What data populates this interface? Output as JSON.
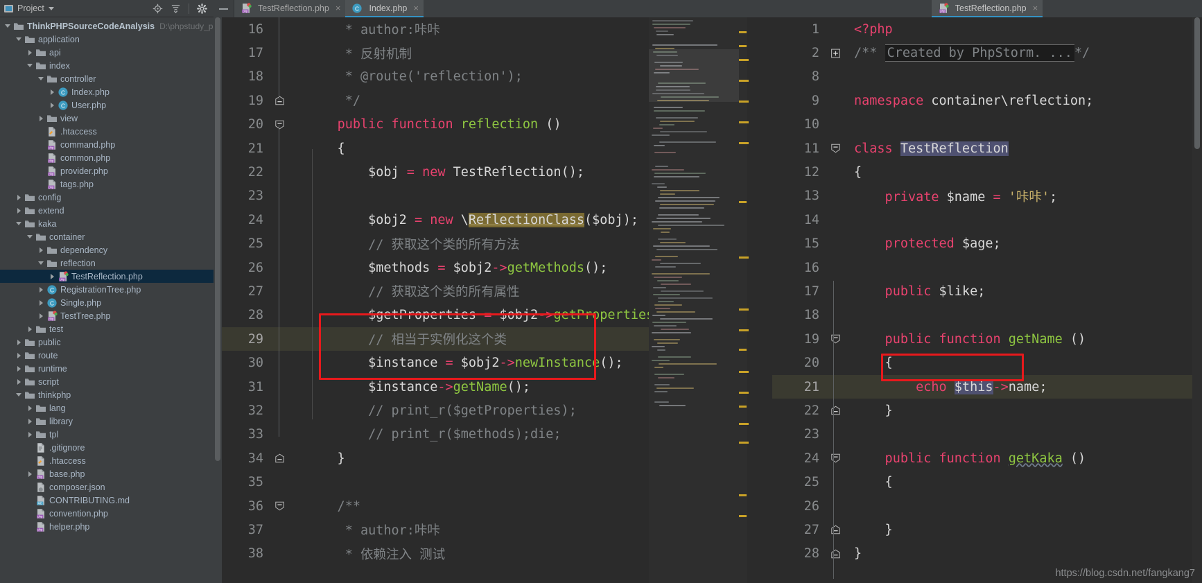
{
  "project_panel": {
    "header": {
      "title": "Project",
      "caret_icon": "chevron-down-icon",
      "icons": [
        "locate-icon",
        "collapse-all-icon",
        "settings-gear-icon"
      ]
    },
    "tree": [
      {
        "depth": 0,
        "arrow": "open",
        "icon": "folder-module",
        "label": "ThinkPHPSourceCodeAnalysis",
        "bold": true,
        "sub": "D:\\phpstudy_pro\\W"
      },
      {
        "depth": 1,
        "arrow": "open",
        "icon": "folder",
        "label": "application"
      },
      {
        "depth": 2,
        "arrow": "closed",
        "icon": "folder",
        "label": "api"
      },
      {
        "depth": 2,
        "arrow": "open",
        "icon": "folder",
        "label": "index"
      },
      {
        "depth": 3,
        "arrow": "open",
        "icon": "folder",
        "label": "controller"
      },
      {
        "depth": 4,
        "arrow": "closed",
        "icon": "php-class",
        "label": "Index.php"
      },
      {
        "depth": 4,
        "arrow": "closed",
        "icon": "php-class",
        "label": "User.php"
      },
      {
        "depth": 3,
        "arrow": "closed",
        "icon": "folder",
        "label": "view"
      },
      {
        "depth": 3,
        "arrow": "none",
        "icon": "htaccess",
        "label": ".htaccess"
      },
      {
        "depth": 3,
        "arrow": "none",
        "icon": "php-file",
        "label": "command.php"
      },
      {
        "depth": 3,
        "arrow": "none",
        "icon": "php-file",
        "label": "common.php"
      },
      {
        "depth": 3,
        "arrow": "none",
        "icon": "php-file",
        "label": "provider.php"
      },
      {
        "depth": 3,
        "arrow": "none",
        "icon": "php-file",
        "label": "tags.php"
      },
      {
        "depth": 1,
        "arrow": "closed",
        "icon": "folder",
        "label": "config"
      },
      {
        "depth": 1,
        "arrow": "closed",
        "icon": "folder",
        "label": "extend"
      },
      {
        "depth": 1,
        "arrow": "open",
        "icon": "folder",
        "label": "kaka"
      },
      {
        "depth": 2,
        "arrow": "open",
        "icon": "folder",
        "label": "container"
      },
      {
        "depth": 3,
        "arrow": "closed",
        "icon": "folder",
        "label": "dependency"
      },
      {
        "depth": 3,
        "arrow": "open",
        "icon": "folder",
        "label": "reflection"
      },
      {
        "depth": 4,
        "arrow": "closed",
        "icon": "php-test",
        "label": "TestReflection.php",
        "selected": true
      },
      {
        "depth": 3,
        "arrow": "closed",
        "icon": "php-class",
        "label": "RegistrationTree.php"
      },
      {
        "depth": 3,
        "arrow": "closed",
        "icon": "php-class",
        "label": "Single.php"
      },
      {
        "depth": 3,
        "arrow": "closed",
        "icon": "php-test",
        "label": "TestTree.php"
      },
      {
        "depth": 2,
        "arrow": "closed",
        "icon": "folder",
        "label": "test"
      },
      {
        "depth": 1,
        "arrow": "closed",
        "icon": "folder",
        "label": "public"
      },
      {
        "depth": 1,
        "arrow": "closed",
        "icon": "folder",
        "label": "route"
      },
      {
        "depth": 1,
        "arrow": "closed",
        "icon": "folder",
        "label": "runtime"
      },
      {
        "depth": 1,
        "arrow": "closed",
        "icon": "folder",
        "label": "script"
      },
      {
        "depth": 1,
        "arrow": "open",
        "icon": "folder",
        "label": "thinkphp"
      },
      {
        "depth": 2,
        "arrow": "closed",
        "icon": "folder",
        "label": "lang"
      },
      {
        "depth": 2,
        "arrow": "closed",
        "icon": "folder",
        "label": "library"
      },
      {
        "depth": 2,
        "arrow": "closed",
        "icon": "folder",
        "label": "tpl"
      },
      {
        "depth": 2,
        "arrow": "none",
        "icon": "text-file",
        "label": ".gitignore"
      },
      {
        "depth": 2,
        "arrow": "none",
        "icon": "htaccess",
        "label": ".htaccess"
      },
      {
        "depth": 2,
        "arrow": "closed",
        "icon": "php-file",
        "label": "base.php"
      },
      {
        "depth": 2,
        "arrow": "none",
        "icon": "json-file",
        "label": "composer.json"
      },
      {
        "depth": 2,
        "arrow": "none",
        "icon": "md-file",
        "label": "CONTRIBUTING.md"
      },
      {
        "depth": 2,
        "arrow": "none",
        "icon": "php-file",
        "label": "convention.php"
      },
      {
        "depth": 2,
        "arrow": "none",
        "icon": "php-file",
        "label": "helper.php"
      }
    ]
  },
  "left_tabs": {
    "collapse_icon": "minimize-icon",
    "tabs": [
      {
        "label": "TestReflection.php",
        "icon": "php-test-icon",
        "active": false,
        "close": "×"
      },
      {
        "label": "Index.php",
        "icon": "php-class-icon",
        "active": true,
        "close": "×"
      }
    ]
  },
  "right_tabs": {
    "tabs": [
      {
        "label": "TestReflection.php",
        "icon": "php-test-icon",
        "active": true,
        "close": "×"
      }
    ]
  },
  "browser_popup": {
    "name": "browser-launcher-popup",
    "browsers": [
      "chrome-icon",
      "edge-icon",
      "opera-icon",
      "safari-icon",
      "firefox-icon"
    ]
  },
  "left_editor": {
    "file": "Index.php",
    "first_line": 16,
    "caret_line": 29,
    "lines": [
      {
        "n": 16,
        "segs": [
          {
            "t": "     * author:咔咔",
            "c": "cmt"
          }
        ]
      },
      {
        "n": 17,
        "segs": [
          {
            "t": "     * 反射机制",
            "c": "cmt"
          }
        ]
      },
      {
        "n": 18,
        "segs": [
          {
            "t": "     * @route('reflection');",
            "c": "cmt"
          }
        ]
      },
      {
        "n": 19,
        "fold": "minus",
        "segs": [
          {
            "t": "     */",
            "c": "cmt"
          }
        ]
      },
      {
        "n": 20,
        "fold": "arrowdown",
        "segs": [
          {
            "t": "    ",
            "c": "plain"
          },
          {
            "t": "public function ",
            "c": "kwm"
          },
          {
            "t": "reflection",
            "c": "fn"
          },
          {
            "t": " ()",
            "c": "plain"
          }
        ]
      },
      {
        "n": 21,
        "segs": [
          {
            "t": "    {",
            "c": "plain"
          }
        ]
      },
      {
        "n": 22,
        "segs": [
          {
            "t": "        $obj ",
            "c": "plain"
          },
          {
            "t": "= ",
            "c": "op"
          },
          {
            "t": "new ",
            "c": "kwm"
          },
          {
            "t": "TestReflection();",
            "c": "plain"
          }
        ]
      },
      {
        "n": 23,
        "segs": []
      },
      {
        "n": 24,
        "segs": [
          {
            "t": "        $obj2 ",
            "c": "plain"
          },
          {
            "t": "= ",
            "c": "op"
          },
          {
            "t": "new ",
            "c": "kwm"
          },
          {
            "t": "\\",
            "c": "plain"
          },
          {
            "t": "ReflectionClass",
            "c": "plain hlbg underline"
          },
          {
            "t": "($obj);",
            "c": "plain"
          }
        ]
      },
      {
        "n": 25,
        "segs": [
          {
            "t": "        // 获取这个类的所有方法",
            "c": "cmt"
          }
        ]
      },
      {
        "n": 26,
        "segs": [
          {
            "t": "        $methods ",
            "c": "plain"
          },
          {
            "t": "= ",
            "c": "op"
          },
          {
            "t": "$obj2",
            "c": "plain"
          },
          {
            "t": "->",
            "c": "op"
          },
          {
            "t": "getMethods",
            "c": "fn"
          },
          {
            "t": "();",
            "c": "plain"
          }
        ]
      },
      {
        "n": 27,
        "segs": [
          {
            "t": "        // 获取这个类的所有属性",
            "c": "cmt"
          }
        ]
      },
      {
        "n": 28,
        "segs": [
          {
            "t": "        $getProperties ",
            "c": "plain"
          },
          {
            "t": "= ",
            "c": "op"
          },
          {
            "t": "$obj2",
            "c": "plain"
          },
          {
            "t": "->",
            "c": "op"
          },
          {
            "t": "getProperties",
            "c": "fn"
          },
          {
            "t": "();",
            "c": "plain"
          }
        ]
      },
      {
        "n": 29,
        "caret": true,
        "segs": [
          {
            "t": "        // 相当于实例化这个类",
            "c": "cmt"
          }
        ]
      },
      {
        "n": 30,
        "segs": [
          {
            "t": "        $instance ",
            "c": "plain"
          },
          {
            "t": "= ",
            "c": "op"
          },
          {
            "t": "$obj2",
            "c": "plain"
          },
          {
            "t": "->",
            "c": "op"
          },
          {
            "t": "newInstance",
            "c": "fn"
          },
          {
            "t": "();",
            "c": "plain"
          }
        ]
      },
      {
        "n": 31,
        "segs": [
          {
            "t": "        $instance",
            "c": "plain"
          },
          {
            "t": "->",
            "c": "op"
          },
          {
            "t": "getName",
            "c": "fn"
          },
          {
            "t": "();",
            "c": "plain"
          }
        ]
      },
      {
        "n": 32,
        "segs": [
          {
            "t": "        // print_r($getProperties);",
            "c": "cmt"
          }
        ]
      },
      {
        "n": 33,
        "segs": [
          {
            "t": "        // print_r($methods);die;",
            "c": "cmt"
          }
        ]
      },
      {
        "n": 34,
        "fold": "minus",
        "segs": [
          {
            "t": "    }",
            "c": "plain"
          }
        ]
      },
      {
        "n": 35,
        "segs": []
      },
      {
        "n": 36,
        "fold": "arrowdown",
        "segs": [
          {
            "t": "    /**",
            "c": "cmt"
          }
        ]
      },
      {
        "n": 37,
        "segs": [
          {
            "t": "     * author:咔咔",
            "c": "cmt"
          }
        ]
      },
      {
        "n": 38,
        "segs": [
          {
            "t": "     * 依赖注入 测试",
            "c": "cmt"
          }
        ]
      }
    ],
    "annotation_box": {
      "name": "red-highlight-box-left",
      "covers_lines": "29-31"
    }
  },
  "right_editor": {
    "file": "TestReflection.php",
    "caret_line": 21,
    "lines": [
      {
        "n": 1,
        "segs": [
          {
            "t": "<?php",
            "c": "kwm"
          }
        ]
      },
      {
        "n": 2,
        "fold": "plus",
        "segs": [
          {
            "t": "/** ",
            "c": "cmt"
          },
          {
            "t": "Created by PhpStorm. ...",
            "c": "cmt foldbg"
          },
          {
            "t": "*/",
            "c": "cmt"
          }
        ]
      },
      {
        "n": 8,
        "segs": []
      },
      {
        "n": 9,
        "segs": [
          {
            "t": "namespace ",
            "c": "kwm"
          },
          {
            "t": "container\\reflection;",
            "c": "plain"
          }
        ]
      },
      {
        "n": 10,
        "segs": []
      },
      {
        "n": 11,
        "fold": "arrowdown",
        "segs": [
          {
            "t": "class ",
            "c": "kwm"
          },
          {
            "t": "TestReflection",
            "c": "plain selbg"
          }
        ]
      },
      {
        "n": 12,
        "segs": [
          {
            "t": "{",
            "c": "plain"
          }
        ]
      },
      {
        "n": 13,
        "segs": [
          {
            "t": "    private ",
            "c": "kwm"
          },
          {
            "t": "$name ",
            "c": "plain"
          },
          {
            "t": "= ",
            "c": "op"
          },
          {
            "t": "'咔咔'",
            "c": "str"
          },
          {
            "t": ";",
            "c": "plain"
          }
        ]
      },
      {
        "n": 14,
        "segs": []
      },
      {
        "n": 15,
        "segs": [
          {
            "t": "    protected ",
            "c": "kwm"
          },
          {
            "t": "$age;",
            "c": "plain"
          }
        ]
      },
      {
        "n": 16,
        "segs": []
      },
      {
        "n": 17,
        "segs": [
          {
            "t": "    public ",
            "c": "kwm"
          },
          {
            "t": "$like;",
            "c": "plain"
          }
        ]
      },
      {
        "n": 18,
        "segs": []
      },
      {
        "n": 19,
        "fold": "arrowdown",
        "segs": [
          {
            "t": "    public function ",
            "c": "kwm"
          },
          {
            "t": "getName",
            "c": "fn"
          },
          {
            "t": " ()",
            "c": "plain"
          }
        ]
      },
      {
        "n": 20,
        "segs": [
          {
            "t": "    {",
            "c": "plain"
          }
        ]
      },
      {
        "n": 21,
        "caret": true,
        "segs": [
          {
            "t": "        echo ",
            "c": "kwm"
          },
          {
            "t": "$this",
            "c": "plain selbg"
          },
          {
            "t": "->",
            "c": "op"
          },
          {
            "t": "name;",
            "c": "plain"
          }
        ]
      },
      {
        "n": 22,
        "fold": "minus",
        "segs": [
          {
            "t": "    }",
            "c": "plain"
          }
        ]
      },
      {
        "n": 23,
        "segs": []
      },
      {
        "n": 24,
        "fold": "arrowdown",
        "segs": [
          {
            "t": "    public function ",
            "c": "kwm"
          },
          {
            "t": "getKaka",
            "c": "fn wavy"
          },
          {
            "t": " ()",
            "c": "plain"
          }
        ]
      },
      {
        "n": 25,
        "segs": [
          {
            "t": "    {",
            "c": "plain"
          }
        ]
      },
      {
        "n": 26,
        "segs": []
      },
      {
        "n": 27,
        "fold": "minus",
        "segs": [
          {
            "t": "    }",
            "c": "plain"
          }
        ]
      },
      {
        "n": 28,
        "fold": "minus",
        "segs": [
          {
            "t": "}",
            "c": "plain"
          }
        ]
      }
    ],
    "annotation_box": {
      "name": "red-highlight-box-right",
      "covers_lines": "21"
    }
  },
  "watermark": {
    "text": "https://blog.csdn.net/fangkang7"
  },
  "colors": {
    "editor_bg": "#2b2b2b",
    "panel_bg": "#3c3f41",
    "selection_tree": "#0d293e",
    "tab_active_underline": "#3592c4",
    "annotation_red": "#e8191c",
    "keyword": "#e8426e",
    "function": "#8ec641",
    "string": "#c9b26b",
    "comment": "#7f8386",
    "caret_row": "#3a3a30",
    "selection": "#4f5171"
  }
}
